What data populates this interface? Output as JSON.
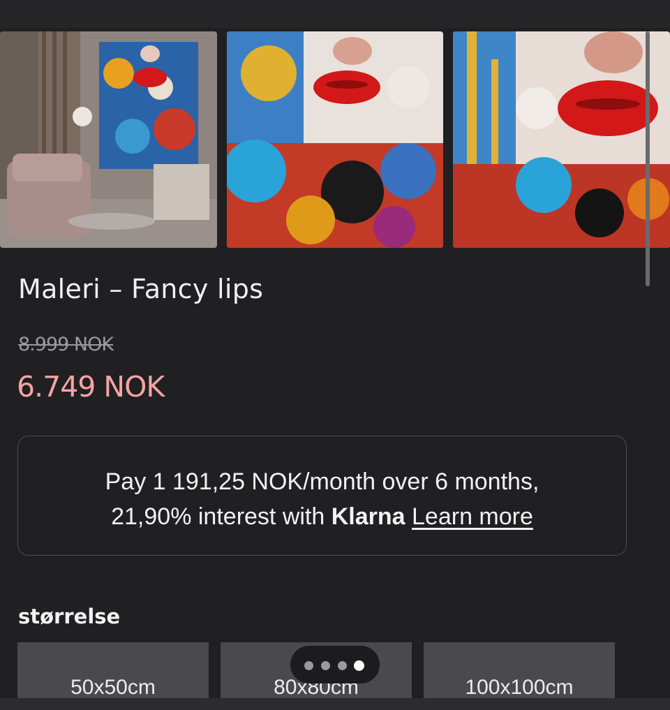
{
  "product": {
    "title": "Maleri – Fancy lips",
    "original_price": "8.999 NOK",
    "sale_price": "6.749 NOK"
  },
  "klarna": {
    "line1": "Pay 1 191,25 NOK/month over 6 months,",
    "line2_prefix": "21,90% interest with ",
    "brand": "Klarna",
    "learn_more": "Learn more"
  },
  "size": {
    "label": "størrelse",
    "options": [
      "50x50cm",
      "80x80cm",
      "100x100cm"
    ]
  },
  "gallery": {
    "images": [
      "room-mockup-image",
      "painting-full-image",
      "painting-closeup-image"
    ]
  },
  "pager": {
    "count": 4,
    "active_index": 3
  },
  "colors": {
    "background": "#202022",
    "sale_price": "#f4a4a4",
    "lips_red": "#d21818"
  }
}
